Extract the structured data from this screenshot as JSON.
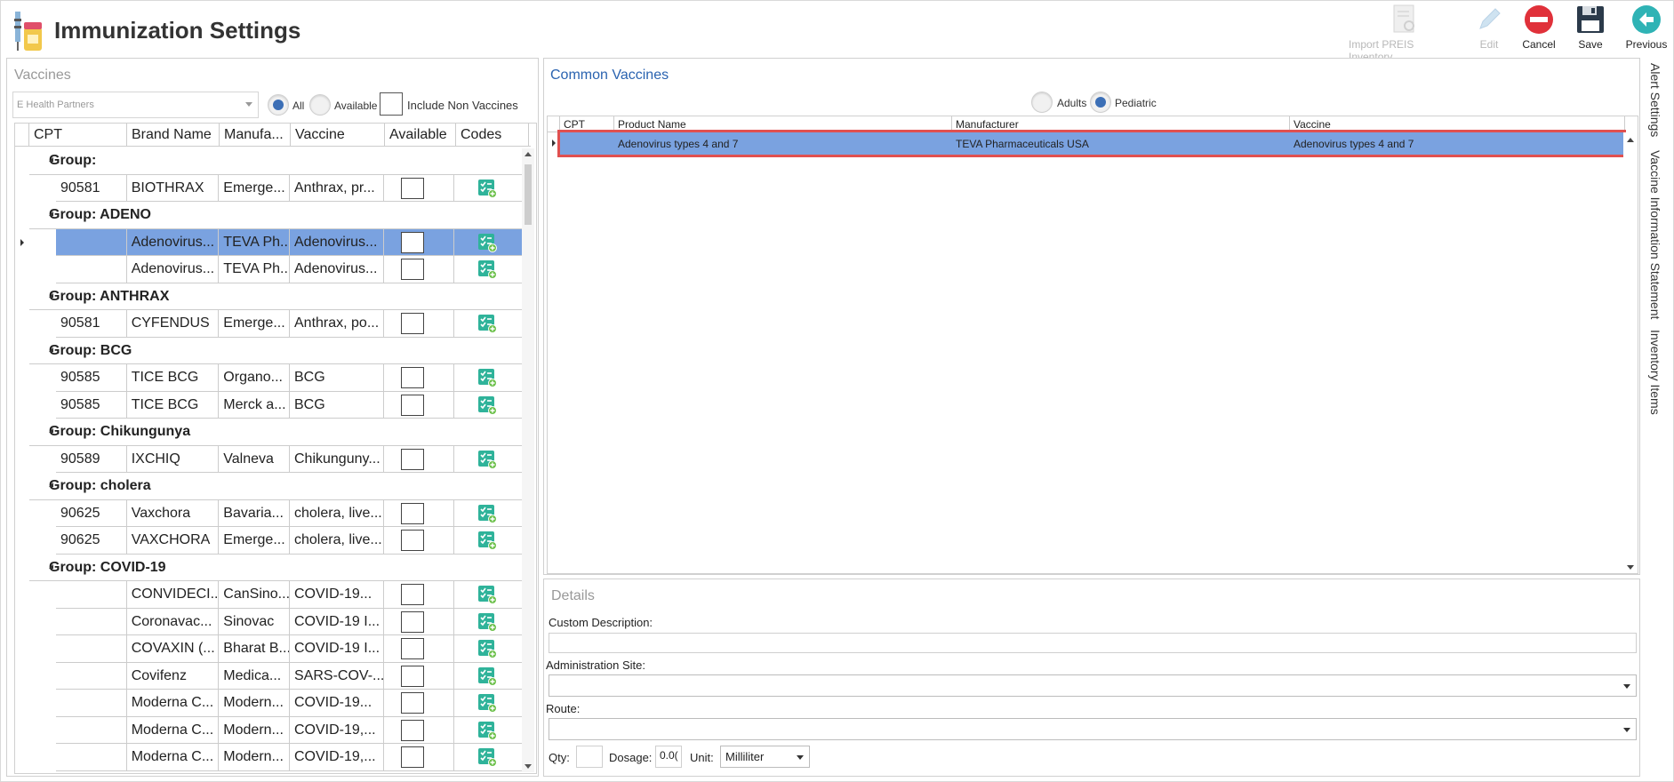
{
  "app": {
    "title": "Immunization Settings",
    "icon": "syringe-vial-icon"
  },
  "toolbar": {
    "import_label": "Import PREIS Inventory",
    "edit_label": "Edit",
    "cancel_label": "Cancel",
    "save_label": "Save",
    "previous_label": "Previous"
  },
  "vaccines": {
    "title": "Vaccines",
    "practice_value": "E Health Partners",
    "filter": {
      "all_label": "All",
      "available_label": "Available",
      "selected": "All",
      "include_non_vaccines_label": "Include Non Vaccines",
      "include_non_vaccines": false
    },
    "columns": [
      "CPT",
      "Brand Name",
      "Manufa...",
      "Vaccine",
      "Available",
      "Codes"
    ],
    "rows": [
      {
        "type": "group",
        "label": "Group:"
      },
      {
        "type": "item",
        "cpt": "90581",
        "brand": "BIOTHRAX",
        "manufacturer": "Emerge...",
        "vaccine": "Anthrax, pr...",
        "available": false
      },
      {
        "type": "group",
        "label": "Group: ADENO"
      },
      {
        "type": "item",
        "cpt": "",
        "brand": "Adenovirus...",
        "manufacturer": "TEVA Ph...",
        "vaccine": "Adenovirus...",
        "available": false,
        "selected": true
      },
      {
        "type": "item",
        "cpt": "",
        "brand": "Adenovirus...",
        "manufacturer": "TEVA Ph...",
        "vaccine": "Adenovirus...",
        "available": false
      },
      {
        "type": "group",
        "label": "Group: ANTHRAX"
      },
      {
        "type": "item",
        "cpt": "90581",
        "brand": "CYFENDUS",
        "manufacturer": "Emerge...",
        "vaccine": "Anthrax, po...",
        "available": false
      },
      {
        "type": "group",
        "label": "Group: BCG"
      },
      {
        "type": "item",
        "cpt": "90585",
        "brand": "TICE BCG",
        "manufacturer": "Organo...",
        "vaccine": "BCG",
        "available": false
      },
      {
        "type": "item",
        "cpt": "90585",
        "brand": "TICE BCG",
        "manufacturer": "Merck a...",
        "vaccine": "BCG",
        "available": false
      },
      {
        "type": "group",
        "label": "Group: Chikungunya"
      },
      {
        "type": "item",
        "cpt": "90589",
        "brand": "IXCHIQ",
        "manufacturer": "Valneva",
        "vaccine": "Chikunguny...",
        "available": false
      },
      {
        "type": "group",
        "label": "Group: cholera"
      },
      {
        "type": "item",
        "cpt": "90625",
        "brand": "Vaxchora",
        "manufacturer": "Bavaria...",
        "vaccine": "cholera, live...",
        "available": false
      },
      {
        "type": "item",
        "cpt": "90625",
        "brand": "VAXCHORA",
        "manufacturer": "Emerge...",
        "vaccine": "cholera, live...",
        "available": false
      },
      {
        "type": "group",
        "label": "Group: COVID-19"
      },
      {
        "type": "item",
        "cpt": "",
        "brand": "CONVIDECI...",
        "manufacturer": "CanSino...",
        "vaccine": "COVID-19...",
        "available": false
      },
      {
        "type": "item",
        "cpt": "",
        "brand": "Coronavac...",
        "manufacturer": "Sinovac",
        "vaccine": "COVID-19 I...",
        "available": false
      },
      {
        "type": "item",
        "cpt": "",
        "brand": "COVAXIN (...",
        "manufacturer": "Bharat B...",
        "vaccine": "COVID-19 I...",
        "available": false
      },
      {
        "type": "item",
        "cpt": "",
        "brand": "Covifenz",
        "manufacturer": "Medica...",
        "vaccine": "SARS-COV-...",
        "available": false
      },
      {
        "type": "item",
        "cpt": "",
        "brand": "Moderna C...",
        "manufacturer": "Modern...",
        "vaccine": "COVID-19...",
        "available": false
      },
      {
        "type": "item",
        "cpt": "",
        "brand": "Moderna C...",
        "manufacturer": "Modern...",
        "vaccine": "COVID-19,...",
        "available": false
      },
      {
        "type": "item",
        "cpt": "",
        "brand": "Moderna C...",
        "manufacturer": "Modern...",
        "vaccine": "COVID-19,...",
        "available": false
      }
    ]
  },
  "common_vaccines": {
    "title": "Common Vaccines",
    "adults_label": "Adults",
    "pediatric_label": "Pediatric",
    "selected": "Pediatric",
    "columns": [
      "CPT",
      "Product Name",
      "Manufacturer",
      "Vaccine"
    ],
    "rows": [
      {
        "cpt": "",
        "product": "Adenovirus types 4 and 7",
        "manufacturer": "TEVA Pharmaceuticals USA",
        "vaccine": "Adenovirus types 4 and 7"
      }
    ]
  },
  "details": {
    "title": "Details",
    "custom_description_label": "Custom Description:",
    "custom_description_value": "",
    "administration_site_label": "Administration Site:",
    "administration_site_value": "",
    "route_label": "Route:",
    "route_value": "",
    "qty_label": "Qty:",
    "qty_value": "",
    "dosage_label": "Dosage:",
    "dosage_value": "0.0(",
    "unit_label": "Unit:",
    "unit_value": "Milliliter"
  },
  "side_tabs": [
    "Alert Settings",
    "Vaccine Information Statement",
    "Inventory Items"
  ],
  "colors": {
    "selection": "#7aa2e0",
    "accent": "#3c6fb6",
    "highlight_border": "#e05050",
    "codes_icon": "#2fb39a"
  }
}
